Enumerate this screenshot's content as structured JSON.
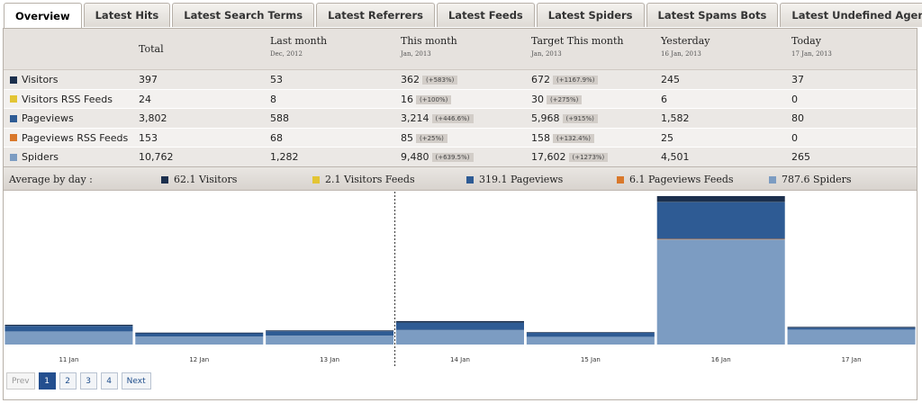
{
  "tabs": [
    "Overview",
    "Latest Hits",
    "Latest Search Terms",
    "Latest Referrers",
    "Latest Feeds",
    "Latest Spiders",
    "Latest Spams Bots",
    "Latest Undefined Agents"
  ],
  "columns": [
    {
      "label": "Total",
      "sub": ""
    },
    {
      "label": "Last month",
      "sub": "Dec, 2012"
    },
    {
      "label": "This month",
      "sub": "Jan, 2013"
    },
    {
      "label": "Target This month",
      "sub": "Jan, 2013"
    },
    {
      "label": "Yesterday",
      "sub": "16 Jan, 2013"
    },
    {
      "label": "Today",
      "sub": "17 Jan, 2013"
    }
  ],
  "rows": [
    {
      "label": "Visitors",
      "color": "#1b2f4d",
      "total": "397",
      "last_month": "53",
      "this_month": "362",
      "this_month_pct": "(+583%)",
      "target": "672",
      "target_pct": "(+1167.9%)",
      "yesterday": "245",
      "today": "37"
    },
    {
      "label": "Visitors RSS Feeds",
      "color": "#e3c534",
      "total": "24",
      "last_month": "8",
      "this_month": "16",
      "this_month_pct": "(+100%)",
      "target": "30",
      "target_pct": "(+275%)",
      "yesterday": "6",
      "today": "0"
    },
    {
      "label": "Pageviews",
      "color": "#2e5b94",
      "total": "3,802",
      "last_month": "588",
      "this_month": "3,214",
      "this_month_pct": "(+446.6%)",
      "target": "5,968",
      "target_pct": "(+915%)",
      "yesterday": "1,582",
      "today": "80"
    },
    {
      "label": "Pageviews RSS Feeds",
      "color": "#d9782b",
      "total": "153",
      "last_month": "68",
      "this_month": "85",
      "this_month_pct": "(+25%)",
      "target": "158",
      "target_pct": "(+132.4%)",
      "yesterday": "25",
      "today": "0"
    },
    {
      "label": "Spiders",
      "color": "#7c9cc2",
      "total": "10,762",
      "last_month": "1,282",
      "this_month": "9,480",
      "this_month_pct": "(+639.5%)",
      "target": "17,602",
      "target_pct": "(+1273%)",
      "yesterday": "4,501",
      "today": "265"
    }
  ],
  "average": {
    "title": "Average by day :",
    "items": [
      {
        "label": "62.1 Visitors",
        "color": "#1b2f4d"
      },
      {
        "label": "2.1 Visitors Feeds",
        "color": "#e3c534"
      },
      {
        "label": "319.1 Pageviews",
        "color": "#2e5b94"
      },
      {
        "label": "6.1 Pageviews Feeds",
        "color": "#d9782b"
      },
      {
        "label": "787.6 Spiders",
        "color": "#7c9cc2"
      }
    ]
  },
  "chart_data": {
    "type": "bar",
    "stacked": true,
    "categories": [
      "11 Jan",
      "12 Jan",
      "13 Jan",
      "14 Jan",
      "15 Jan",
      "16 Jan",
      "17 Jan"
    ],
    "series": [
      {
        "name": "Spiders",
        "color": "#7c9cc2",
        "values": [
          560,
          340,
          380,
          620,
          330,
          4501,
          640
        ]
      },
      {
        "name": "Pageviews Feeds",
        "color": "#d9782b",
        "values": [
          2,
          1,
          1,
          3,
          1,
          25,
          0
        ]
      },
      {
        "name": "Pageviews",
        "color": "#2e5b94",
        "values": [
          240,
          140,
          190,
          320,
          170,
          1582,
          80
        ]
      },
      {
        "name": "Visitors Feeds",
        "color": "#e3c534",
        "values": [
          1,
          0,
          0,
          2,
          0,
          6,
          0
        ]
      },
      {
        "name": "Visitors",
        "color": "#1b2f4d",
        "values": [
          45,
          30,
          35,
          60,
          28,
          245,
          37
        ]
      }
    ],
    "grid": false,
    "divider_after": "13 Jan"
  },
  "pager": {
    "prev": "Prev",
    "pages": [
      "1",
      "2",
      "3",
      "4"
    ],
    "current": "1",
    "next": "Next"
  }
}
